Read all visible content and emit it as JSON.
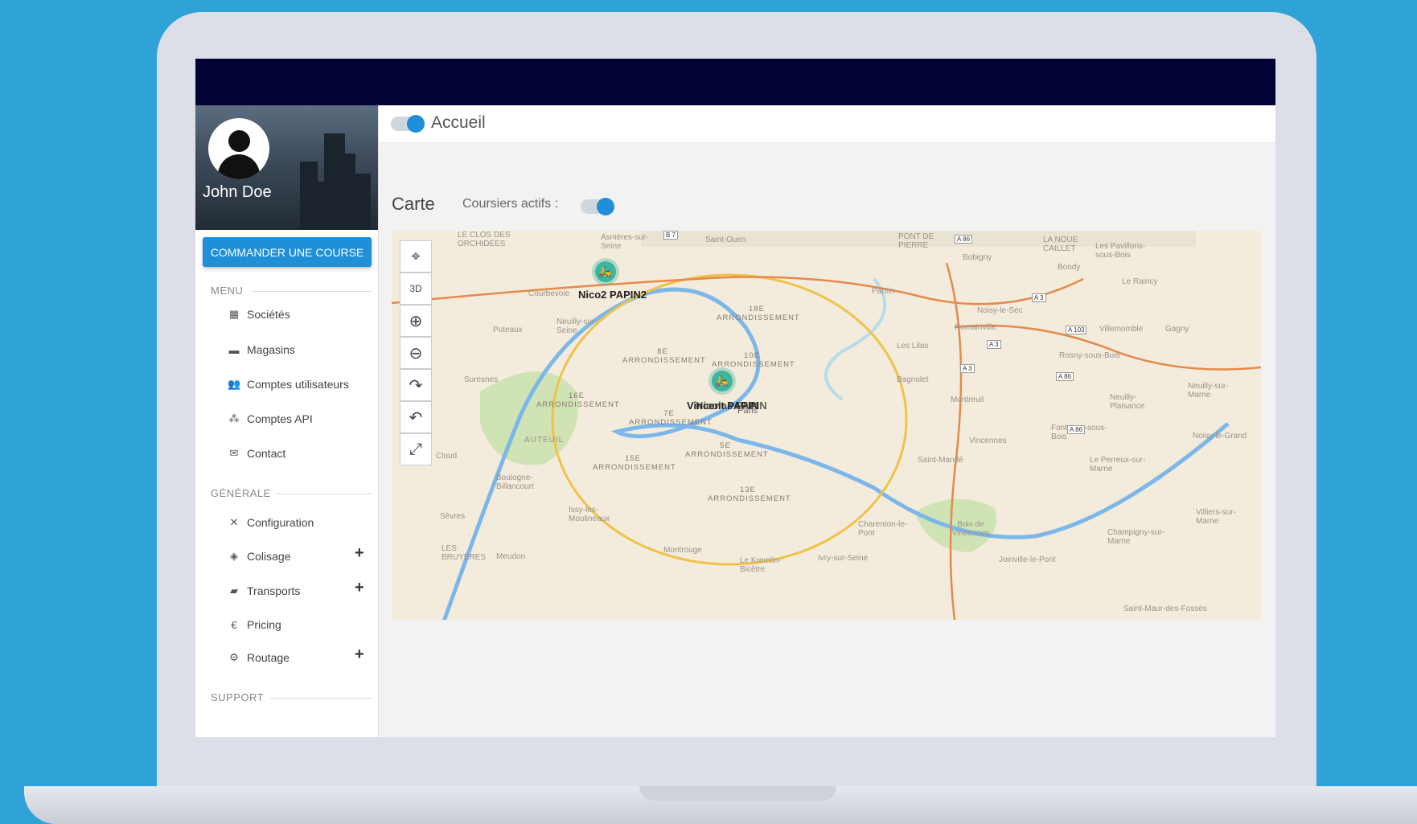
{
  "user": {
    "name": "John Doe"
  },
  "sidebar": {
    "order_button": "COMMANDER UNE COURSE",
    "menu_label": "MENU",
    "menu_items": [
      {
        "label": "Sociétés",
        "icon": "building-icon"
      },
      {
        "label": "Magasins",
        "icon": "store-icon"
      },
      {
        "label": "Comptes utilisateurs",
        "icon": "users-icon"
      },
      {
        "label": "Comptes API",
        "icon": "api-icon"
      },
      {
        "label": "Contact",
        "icon": "mail-icon"
      }
    ],
    "general_label": "GÉNÉRALE",
    "general_items": [
      {
        "label": "Configuration",
        "icon": "tools-icon",
        "expandable": false
      },
      {
        "label": "Colisage",
        "icon": "box-icon",
        "expandable": true
      },
      {
        "label": "Transports",
        "icon": "truck-icon",
        "expandable": true
      },
      {
        "label": "Pricing",
        "icon": "euro-icon",
        "expandable": false
      },
      {
        "label": "Routage",
        "icon": "settings-icon",
        "expandable": true
      }
    ],
    "support_label": "SUPPORT"
  },
  "header": {
    "title": "Accueil"
  },
  "main": {
    "section_title": "Carte",
    "active_couriers_label": "Coursiers actifs :"
  },
  "map": {
    "couriers": [
      {
        "name": "Nico2 PAPIN2"
      },
      {
        "name": "Vincent PAPIN"
      },
      {
        "name": "Nicolas PAPIN"
      }
    ],
    "center_label": "Paris",
    "labels": {
      "arr18": "18E ARRONDISSEMENT",
      "arr8": "8E ARRONDISSEMENT",
      "arr10": "10E ARRONDISSEMENT",
      "arr16": "16E ARRONDISSEMENT",
      "arr7": "7E ARRONDISSEMENT",
      "arr5": "5E ARRONDISSEMENT",
      "arr15": "15E ARRONDISSEMENT",
      "arr13": "13E ARRONDISSEMENT",
      "clos": "LE CLOS DES ORCHIDÉES",
      "asnieres": "Asnières-sur-Seine",
      "saintouen": "Saint-Ouen",
      "pontdepierre": "PONT DE PIERRE",
      "bobigny": "Bobigny",
      "noue": "LA NOUE CAILLET",
      "pavillons": "Les Pavillons-sous-Bois",
      "bondy": "Bondy",
      "raincy": "Le Raincy",
      "courbevoie": "Courbevoie",
      "neuilly": "Neuilly-sur-Seine",
      "puteaux": "Puteaux",
      "pantin": "Pantin",
      "noisylesec": "Noisy-le-Sec",
      "romainville": "Romainville",
      "lilas": "Les Lilas",
      "villemomble": "Villemomble",
      "gagny": "Gagny",
      "rosny": "Rosny-sous-Bois",
      "bagnolet": "Bagnolet",
      "montreuil": "Montreuil",
      "neuillyplaisance": "Neuilly-Plaisance",
      "neuillymarne": "Neuilly-sur-Marne",
      "fontenay": "Fontenay-sous-Bois",
      "vincennes": "Vincennes",
      "saintmande": "Saint-Mandé",
      "boisvincennes": "Bois de Vincennes",
      "perreux": "Le Perreux-sur-Marne",
      "noisylegrand": "Noisy-le-Grand",
      "suresnes": "Suresnes",
      "auteuil": "AUTEUIL",
      "cloud": "Cloud",
      "boulogne": "Boulogne-Billancourt",
      "sevres": "Sèvres",
      "issy": "Issy-les-Moulineaux",
      "bruyeres": "LES BRUYÈRES",
      "meudon": "Meudon",
      "montrouge": "Montrouge",
      "kremlin": "Le Kremlin-Bicêtre",
      "ivry": "Ivry-sur-Seine",
      "charenton": "Charenton-le-Pont",
      "joinville": "Joinville-le-Pont",
      "champigny": "Champigny-sur-Marne",
      "villiers": "Villiers-sur-Marne",
      "saintmaurdes": "Saint-Maur-des-Fossés"
    },
    "road_badges": [
      "B 7",
      "A 86",
      "A 3",
      "A 103",
      "A 3",
      "A 3",
      "A 86",
      "A 86"
    ]
  },
  "colors": {
    "accent": "#1e8fd8",
    "topbar": "#020334",
    "background": "#2fa3d8",
    "courier": "#3fb59e"
  }
}
